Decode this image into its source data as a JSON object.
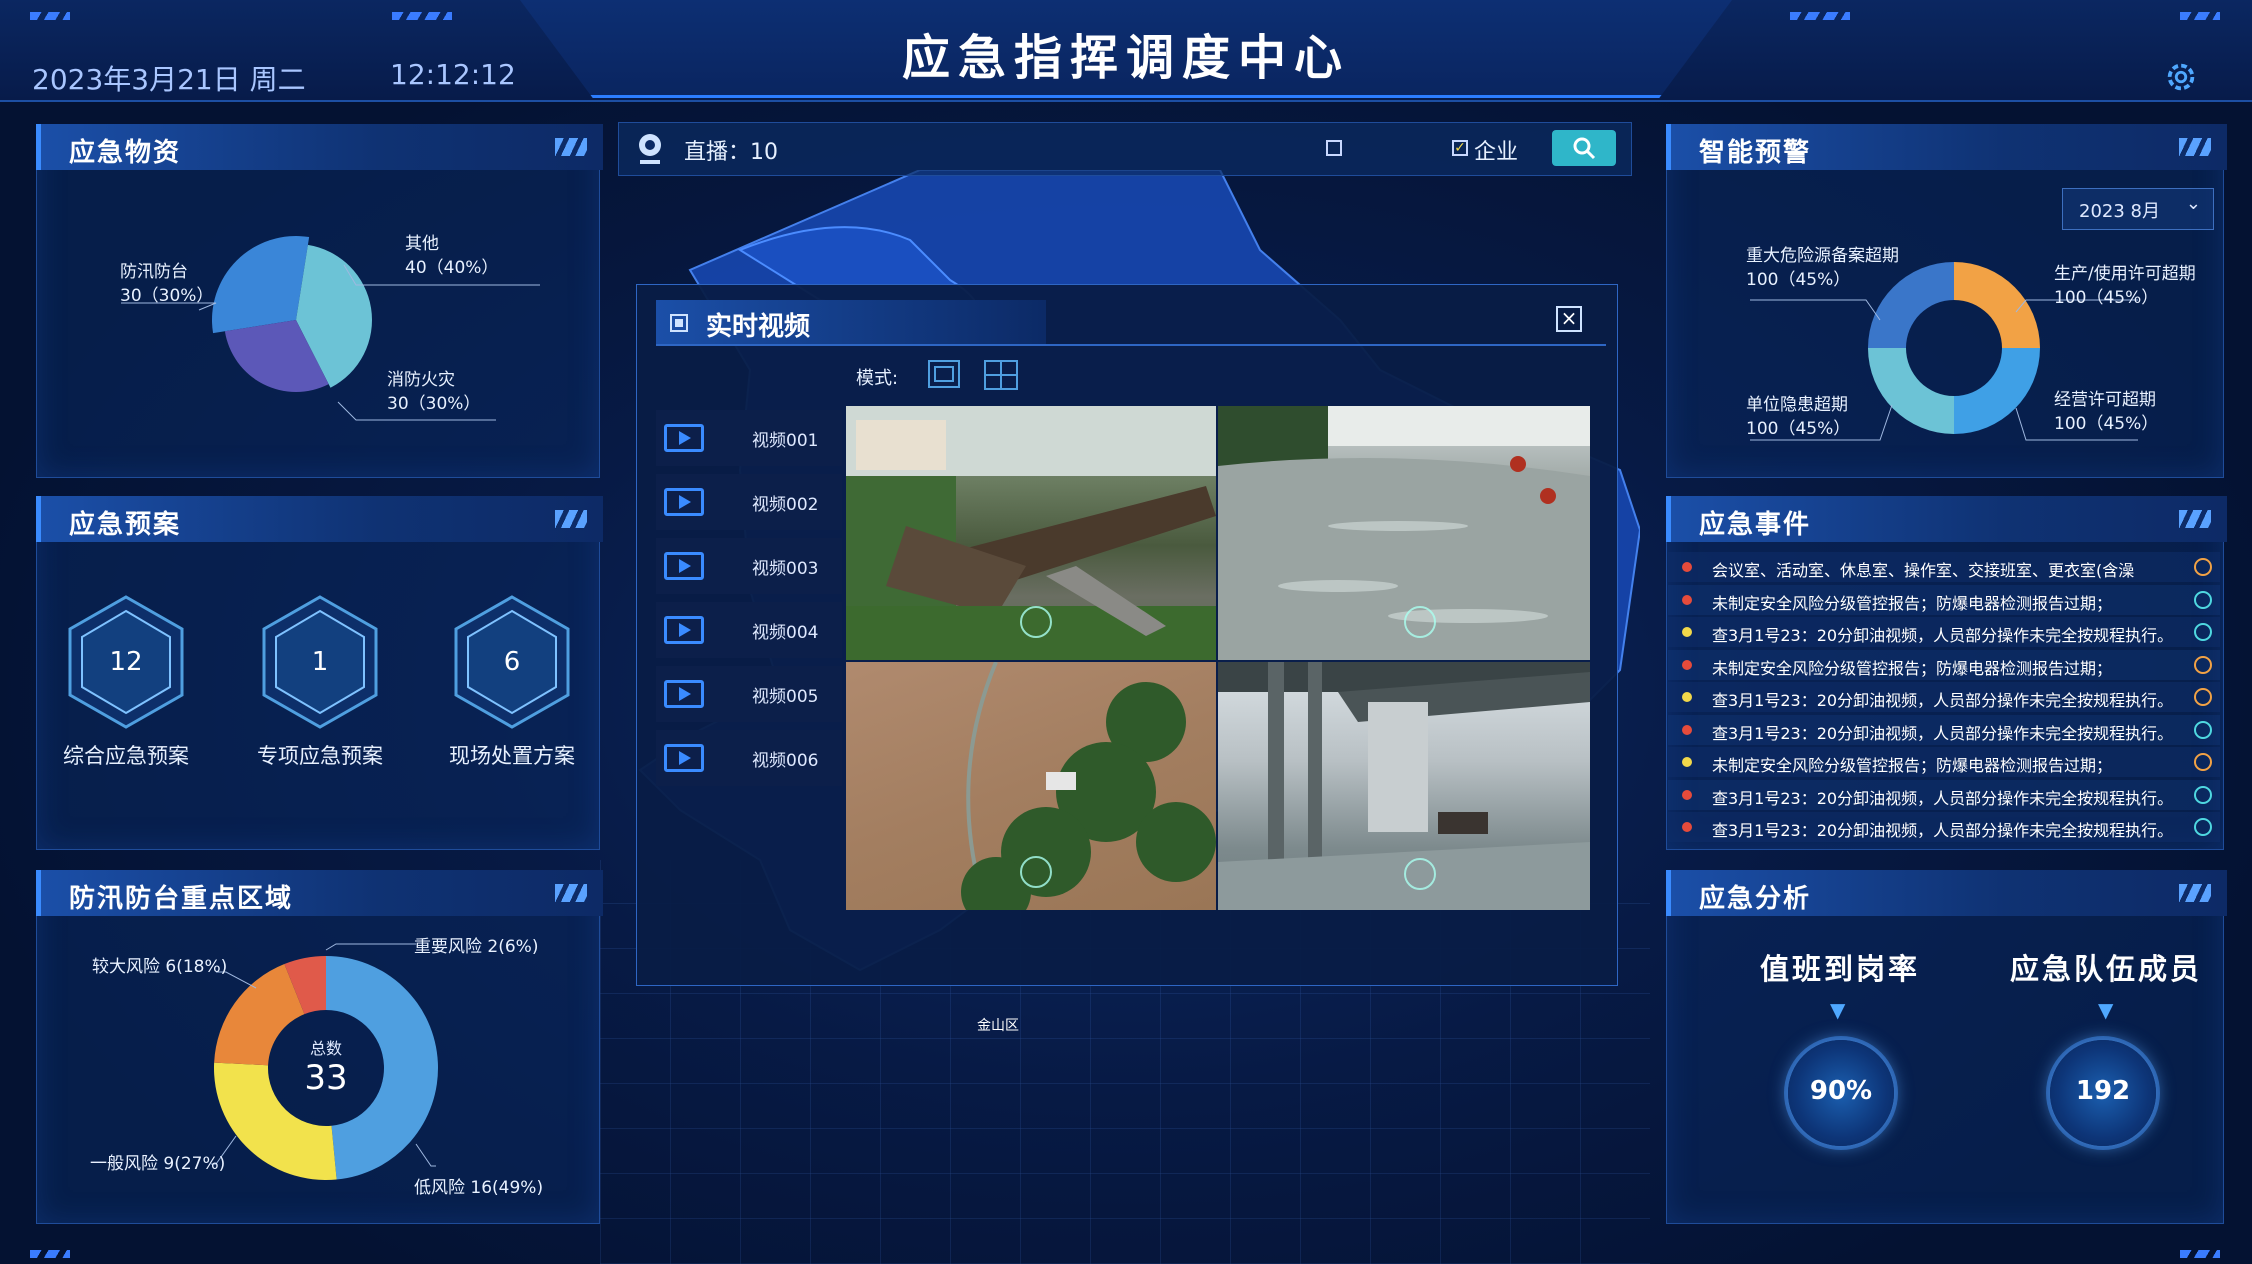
{
  "header": {
    "title": "应急指挥调度中心",
    "date": "2023年3月21日 周二",
    "time": "12:12:12"
  },
  "toolbar": {
    "live_label": "直播：10",
    "enterprise_label": "企业"
  },
  "panels": {
    "supplies": {
      "title": "应急物资",
      "slices": [
        {
          "name": "防汛防台",
          "value": 30,
          "percent": "30%",
          "display": "30（30%）",
          "color": "#3a86d8"
        },
        {
          "name": "其他",
          "value": 40,
          "percent": "40%",
          "display": "40（40%）",
          "color": "#6cc3d6"
        },
        {
          "name": "消防火灾",
          "value": 30,
          "percent": "30%",
          "display": "30（30%）",
          "color": "#5c58b8"
        }
      ]
    },
    "plans": {
      "title": "应急预案",
      "items": [
        {
          "count": "12",
          "label": "综合应急预案"
        },
        {
          "count": "1",
          "label": "专项应急预案"
        },
        {
          "count": "6",
          "label": "现场处置方案"
        }
      ]
    },
    "flood": {
      "title": "防汛防台重点区域",
      "total_label": "总数",
      "total": "33",
      "slices": [
        {
          "name": "低风险",
          "value": 16,
          "display": "低风险 16(49%)",
          "color": "#4f9fe0"
        },
        {
          "name": "一般风险",
          "value": 9,
          "display": "一般风险 9(27%)",
          "color": "#f2e24c"
        },
        {
          "name": "较大风险",
          "value": 6,
          "display": "较大风险 6(18%)",
          "color": "#e8873a"
        },
        {
          "name": "重要风险",
          "value": 2,
          "display": "重要风险 2(6%)",
          "color": "#e05a4a"
        }
      ]
    },
    "warning": {
      "title": "智能预警",
      "month": "2023 8月",
      "slices": [
        {
          "name": "重大危险源备案超期",
          "display": "100（45%）",
          "value": 100,
          "color": "#3a76c9"
        },
        {
          "name": "生产/使用许可超期",
          "display": "100（45%）",
          "value": 100,
          "color": "#f2a245"
        },
        {
          "name": "经营许可超期",
          "display": "100（45%）",
          "value": 100,
          "color": "#3fa0e6"
        },
        {
          "name": "单位隐患超期",
          "display": "100（45%）",
          "value": 100,
          "color": "#6cc3d6"
        }
      ]
    },
    "events": {
      "title": "应急事件",
      "rows": [
        {
          "text": "会议室、活动室、休息室、操作室、交接班室、更衣室(含澡",
          "dot": "#e64b3b",
          "status": "pending"
        },
        {
          "text": "未制定安全风险分级管控报告；防爆电器检测报告过期；",
          "dot": "#e64b3b",
          "status": "done"
        },
        {
          "text": "查3月1号23：20分卸油视频，人员部分操作未完全按规程执行。",
          "dot": "#f2d84a",
          "status": "done"
        },
        {
          "text": "未制定安全风险分级管控报告；防爆电器检测报告过期；",
          "dot": "#e64b3b",
          "status": "pending"
        },
        {
          "text": "查3月1号23：20分卸油视频，人员部分操作未完全按规程执行。",
          "dot": "#f2d84a",
          "status": "pending"
        },
        {
          "text": "查3月1号23：20分卸油视频，人员部分操作未完全按规程执行。",
          "dot": "#e64b3b",
          "status": "done"
        },
        {
          "text": "未制定安全风险分级管控报告；防爆电器检测报告过期；",
          "dot": "#f2d84a",
          "status": "pending"
        },
        {
          "text": "查3月1号23：20分卸油视频，人员部分操作未完全按规程执行。",
          "dot": "#e64b3b",
          "status": "done"
        },
        {
          "text": "查3月1号23：20分卸油视频，人员部分操作未完全按规程执行。",
          "dot": "#e64b3b",
          "status": "done"
        }
      ]
    },
    "analysis": {
      "title": "应急分析",
      "duty_label": "值班到岗率",
      "duty_value": "90%",
      "team_label": "应急队伍成员",
      "team_value": "192"
    }
  },
  "video": {
    "title": "实时视频",
    "mode_label": "模式:",
    "items": [
      "视频001",
      "视频002",
      "视频003",
      "视频004",
      "视频005",
      "视频006"
    ]
  },
  "map": {
    "district_label": "金山区"
  }
}
